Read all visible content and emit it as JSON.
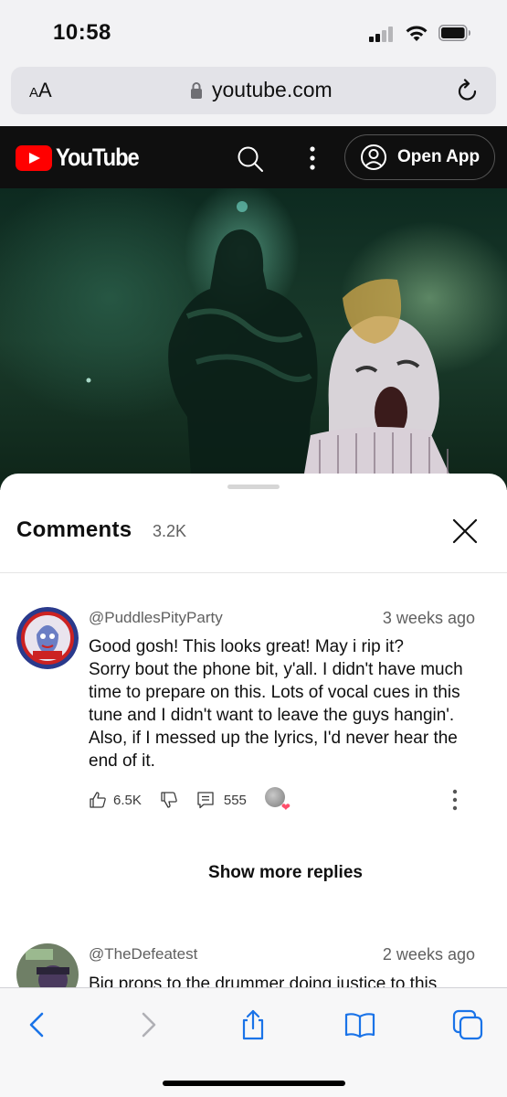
{
  "status_bar": {
    "time": "10:58"
  },
  "address_bar": {
    "aa_label_small": "A",
    "aa_label_large": "A",
    "url": "youtube.com"
  },
  "yt_header": {
    "wordmark": "YouTube",
    "open_app_label": "Open App"
  },
  "comments_panel": {
    "title": "Comments",
    "count": "3.2K",
    "comments": [
      {
        "author": "@PuddlesPityParty",
        "time": "3 weeks ago",
        "text": "Good gosh! This looks great! May i rip it?\nSorry bout the phone bit, y'all. I didn't have much time to prepare on this. Lots of vocal cues in this tune and I didn't want to leave the guys hangin'. Also, if I messed up the lyrics, I'd never hear the end of it.",
        "likes": "6.5K",
        "replies": "555",
        "avatar_text": "PITY PARTY"
      },
      {
        "author": "@TheDefeatest",
        "time": "2 weeks ago",
        "text": "Big props to the drummer doing justice to this"
      }
    ],
    "show_more_replies": "Show more replies"
  },
  "colors": {
    "youtube_red": "#ff0000",
    "safari_blue": "#1a73e8",
    "header_bg": "#0f0f0f"
  },
  "icons": [
    "lock-icon",
    "reload-icon",
    "search-icon",
    "kebab-icon",
    "account-icon",
    "close-icon",
    "like-icon",
    "dislike-icon",
    "reply-icon",
    "back-icon",
    "forward-icon",
    "share-icon",
    "bookmarks-icon",
    "tabs-icon"
  ]
}
